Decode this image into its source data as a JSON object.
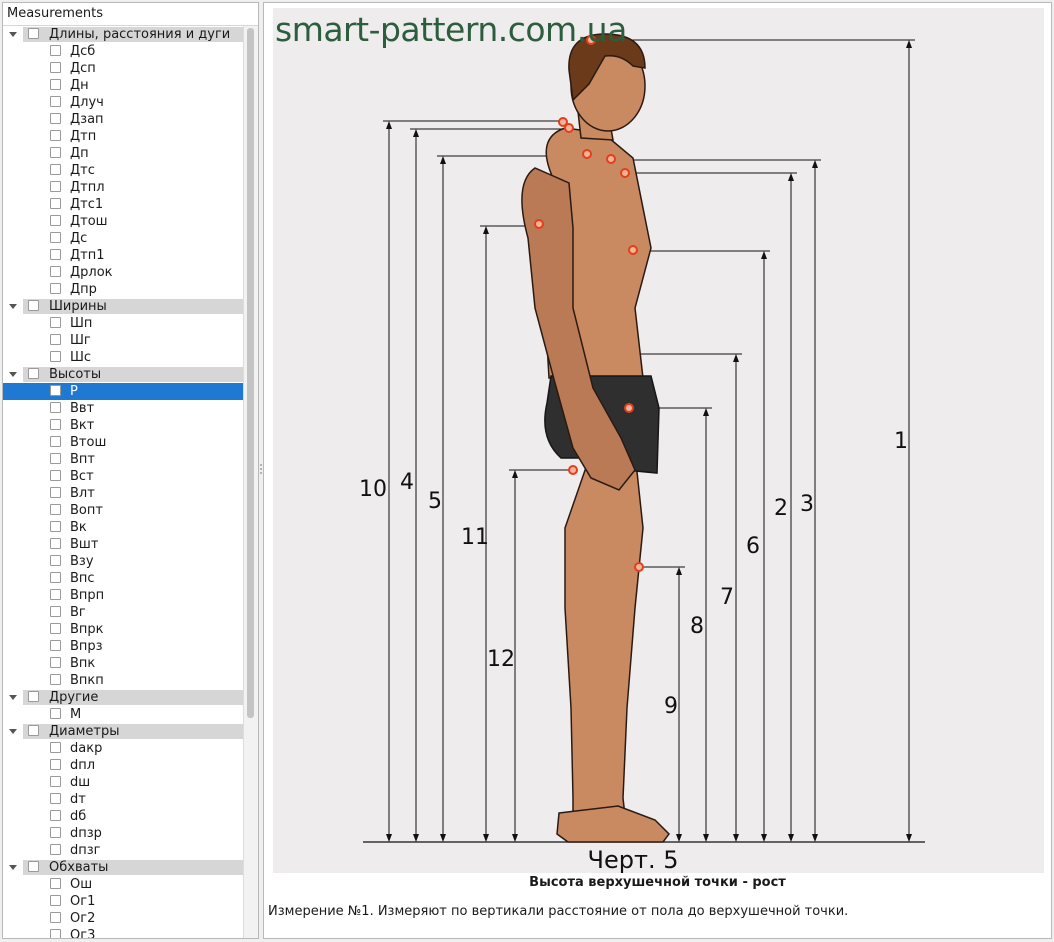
{
  "tree": {
    "header": "Measurements",
    "groups": [
      {
        "label": "Длины, расстояния и дуги",
        "items": [
          "Дсб",
          "Дсп",
          "Дн",
          "Длуч",
          "Дзап",
          "Дтп",
          "Дп",
          "Дтс",
          "Дтпл",
          "Дтс1",
          "Дтош",
          "Дс",
          "Дтп1",
          "Дрлок",
          "Дпр"
        ]
      },
      {
        "label": "Ширины",
        "items": [
          "Шп",
          "Шг",
          "Шс"
        ]
      },
      {
        "label": "Высоты",
        "items": [
          "Р",
          "Ввт",
          "Вкт",
          "Втош",
          "Впт",
          "Вст",
          "Влт",
          "Вопт",
          "Вк",
          "Вшт",
          "Взу",
          "Впс",
          "Впрп",
          "Вг",
          "Впрк",
          "Впрз",
          "Впк",
          "Впкп"
        ]
      },
      {
        "label": "Другие",
        "items": [
          "М"
        ]
      },
      {
        "label": "Диаметры",
        "items": [
          "dакр",
          "dпл",
          "dш",
          "dт",
          "dб",
          "dпзр",
          "dпзг"
        ]
      },
      {
        "label": "Обхваты",
        "items": [
          "Ош",
          "Ог1",
          "Ог2",
          "Ог3"
        ]
      }
    ],
    "selected": "Р"
  },
  "figure": {
    "watermark": "smart-pattern.com.ua",
    "drawing_label": "Черт. 5",
    "dimension_numbers": [
      {
        "label": "1"
      },
      {
        "label": "2"
      },
      {
        "label": "3"
      },
      {
        "label": "4"
      },
      {
        "label": "5"
      },
      {
        "label": "6"
      },
      {
        "label": "7"
      },
      {
        "label": "8"
      },
      {
        "label": "9"
      },
      {
        "label": "10"
      },
      {
        "label": "11"
      },
      {
        "label": "12"
      }
    ]
  },
  "caption": "Высота верхушечной точки - рост",
  "description": "Измерение №1. Измеряют по вертикали расстояние от пола до верхушечной точки.",
  "colors": {
    "selection": "#1f78d1",
    "group_bg": "#d6d6d6",
    "marker": "#e0401a",
    "skin": "#c98a62",
    "shorts": "#2f2f2f",
    "watermark": "#2c5d3c"
  }
}
